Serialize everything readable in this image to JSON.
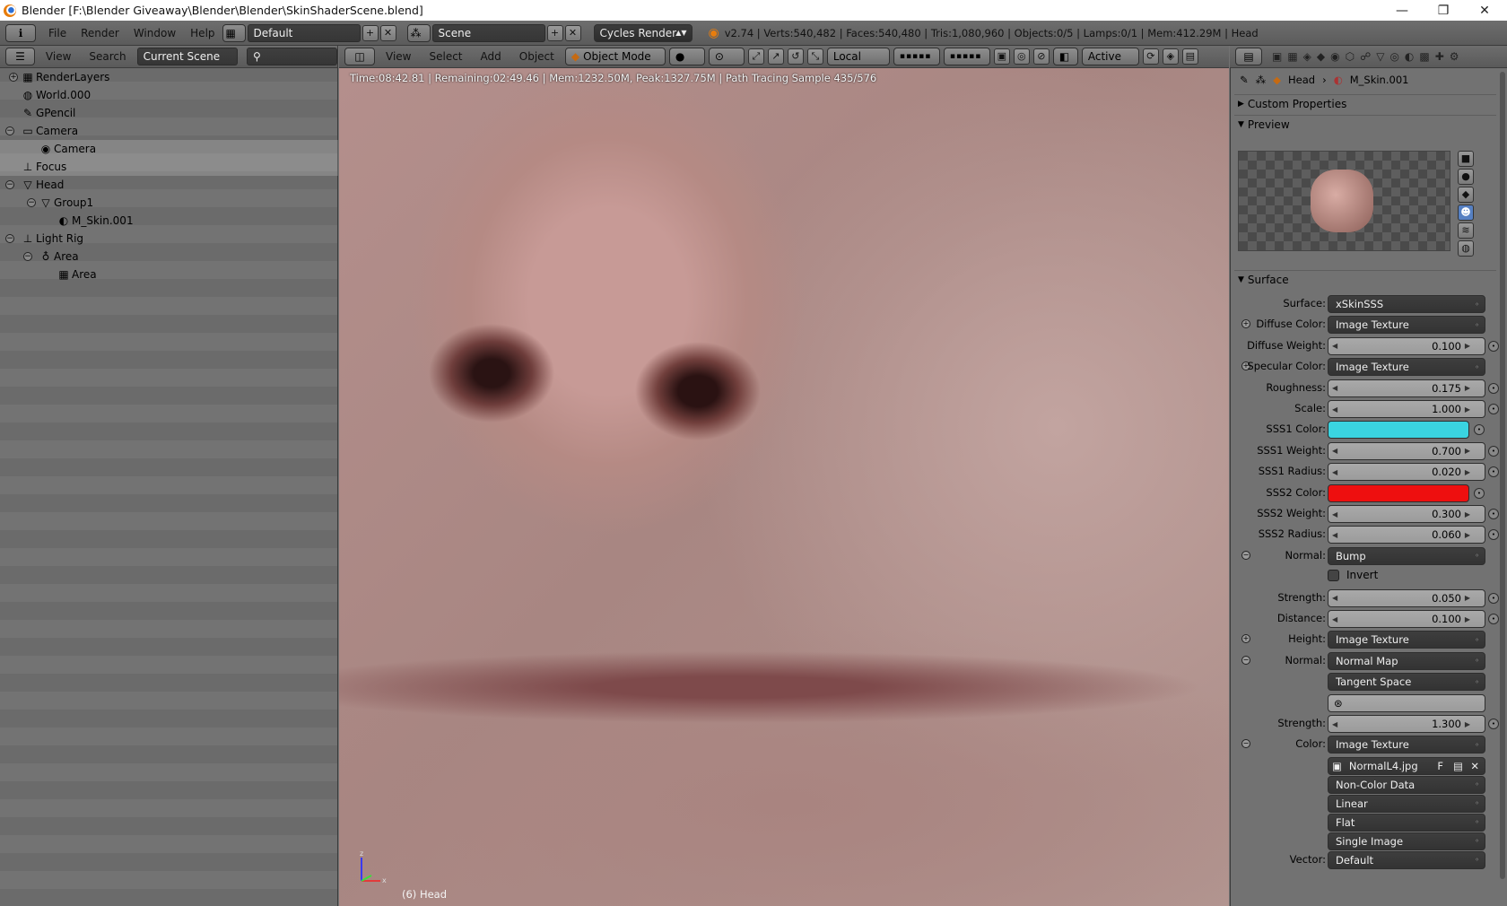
{
  "window": {
    "title": "Blender [F:\\Blender Giveaway\\Blender\\Blender\\SkinShaderScene.blend]",
    "min": "—",
    "max": "❐",
    "close": "✕"
  },
  "menubar": {
    "info": "ℹ",
    "file": "File",
    "render": "Render",
    "window": "Window",
    "help": "Help",
    "layout": "Default",
    "scene": "Scene",
    "engine": "Cycles Render",
    "stats": "v2.74 | Verts:540,482 | Faces:540,480 | Tris:1,080,960 | Objects:0/5 | Lamps:0/1 | Mem:412.29M | Head"
  },
  "outliner": {
    "view": "View",
    "search": "Search",
    "display": "Current Scene",
    "rows": [
      {
        "label": "RenderLayers",
        "icon": "▦",
        "x": 40
      },
      {
        "label": "World.000",
        "icon": "◍",
        "x": 40
      },
      {
        "label": "GPencil",
        "icon": "✎",
        "x": 40
      },
      {
        "label": "Camera",
        "icon": "▭",
        "x": 40
      },
      {
        "label": "Camera",
        "icon": "◉",
        "x": 60
      },
      {
        "label": "Focus",
        "icon": "⊥",
        "x": 40
      },
      {
        "label": "Head",
        "icon": "▽",
        "x": 40
      },
      {
        "label": "Group1",
        "icon": "▽",
        "x": 60
      },
      {
        "label": "M_Skin.001",
        "icon": "◐",
        "x": 80
      },
      {
        "label": "Light Rig",
        "icon": "⊥",
        "x": 40
      },
      {
        "label": "Area",
        "icon": "♁",
        "x": 60
      },
      {
        "label": "Area",
        "icon": "▦",
        "x": 80
      }
    ]
  },
  "viewport": {
    "view": "View",
    "select": "Select",
    "add": "Add",
    "object": "Object",
    "mode": "Object Mode",
    "orient": "Local",
    "pivot": "Active",
    "render_info": "Time:08:42.81 | Remaining:02:49.46 | Mem:1232.50M, Peak:1327.75M | Path Tracing Sample 435/576",
    "object_label": "(6) Head"
  },
  "properties": {
    "breadcrumb": {
      "object": "Head",
      "material": "M_Skin.001"
    },
    "custom_props": "Custom Properties",
    "preview": "Preview",
    "surface_panel": "Surface",
    "rows": [
      {
        "label": "Surface:",
        "type": "menu",
        "value": "xSkinSSS"
      },
      {
        "label": "Diffuse Color:",
        "type": "menu",
        "value": "Image Texture",
        "sock": "+"
      },
      {
        "label": "Diffuse Weight:",
        "type": "num",
        "value": "0.100"
      },
      {
        "label": "Specular Color:",
        "type": "menu",
        "value": "Image Texture",
        "sock": "+"
      },
      {
        "label": "Roughness:",
        "type": "num",
        "value": "0.175"
      },
      {
        "label": "Scale:",
        "type": "num",
        "value": "1.000"
      },
      {
        "label": "SSS1 Color:",
        "type": "color",
        "value": "#3ad4e0"
      },
      {
        "label": "SSS1 Weight:",
        "type": "num",
        "value": "0.700"
      },
      {
        "label": "SSS1 Radius:",
        "type": "num",
        "value": "0.020"
      },
      {
        "label": "SSS2 Color:",
        "type": "color",
        "value": "#ee0f0f"
      },
      {
        "label": "SSS2 Weight:",
        "type": "num",
        "value": "0.300"
      },
      {
        "label": "SSS2 Radius:",
        "type": "num",
        "value": "0.060"
      },
      {
        "label": "Normal:",
        "type": "menu",
        "value": "Bump",
        "sock": "−"
      },
      {
        "label": "",
        "type": "check",
        "value": "Invert"
      },
      {
        "label": "Strength:",
        "type": "num",
        "value": "0.050"
      },
      {
        "label": "Distance:",
        "type": "num",
        "value": "0.100"
      },
      {
        "label": "Height:",
        "type": "menu",
        "value": "Image Texture",
        "sock": "+"
      },
      {
        "label": "Normal:",
        "type": "menu",
        "value": "Normal Map",
        "sock": "−"
      },
      {
        "label": "",
        "type": "menu",
        "value": "Tangent Space"
      },
      {
        "label": "",
        "type": "field",
        "value": ""
      },
      {
        "label": "Strength:",
        "type": "num",
        "value": "1.300"
      },
      {
        "label": "Color:",
        "type": "menu",
        "value": "Image Texture",
        "sock": "−"
      },
      {
        "label": "",
        "type": "image",
        "value": "NormalL4.jpg"
      },
      {
        "label": "",
        "type": "menu",
        "value": "Non-Color Data"
      },
      {
        "label": "",
        "type": "menu",
        "value": "Linear"
      },
      {
        "label": "",
        "type": "menu",
        "value": "Flat"
      },
      {
        "label": "",
        "type": "menu",
        "value": "Single Image"
      },
      {
        "label": "Vector:",
        "type": "menu",
        "value": "Default"
      }
    ]
  }
}
